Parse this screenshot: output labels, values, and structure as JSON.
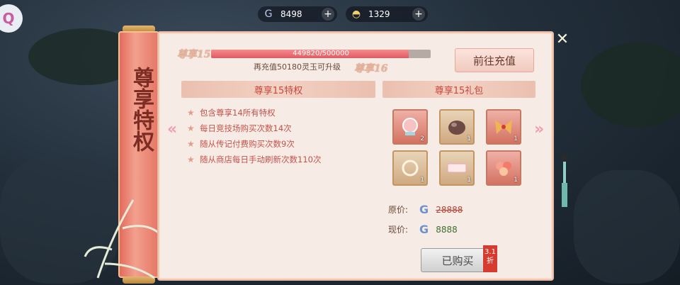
{
  "currency": [
    {
      "icon": "spirit-jade-icon",
      "value": "8498"
    },
    {
      "icon": "gold-ingot-icon",
      "value": "1329"
    }
  ],
  "scroll_title": "尊享特权",
  "progress": {
    "current_level": "尊享15",
    "next_level": "尊享16",
    "text": "449820/500000",
    "fraction": 0.8996,
    "hint": "再充值50180灵玉可升级"
  },
  "recharge_button": "前往充值",
  "privileges": {
    "title": "尊享15特权",
    "items": [
      "包含尊享14所有特权",
      "每日竞技场购买次数14次",
      "随从传记付费购买次数9次",
      "随从商店每日手动刷新次数110次"
    ]
  },
  "gift": {
    "title": "尊享15礼包",
    "items": [
      {
        "name": "crystal-ball-icon",
        "qty": "2",
        "style": "red"
      },
      {
        "name": "ore-stone-icon",
        "qty": "1",
        "style": "gold"
      },
      {
        "name": "ribbon-bow-icon",
        "qty": "1",
        "style": "red"
      },
      {
        "name": "ring-icon",
        "qty": "1",
        "style": "gold"
      },
      {
        "name": "scroll-paper-icon",
        "qty": "1",
        "style": "gold"
      },
      {
        "name": "flower-bouquet-icon",
        "qty": "1",
        "style": "red"
      }
    ],
    "original_price_label": "原价:",
    "original_price": "28888",
    "current_price_label": "现价:",
    "current_price": "8888",
    "button": "已购买",
    "discount": "3.1折"
  },
  "colors": {
    "accent_red": "#c9473f",
    "panel_bg": "#f6ece5"
  }
}
